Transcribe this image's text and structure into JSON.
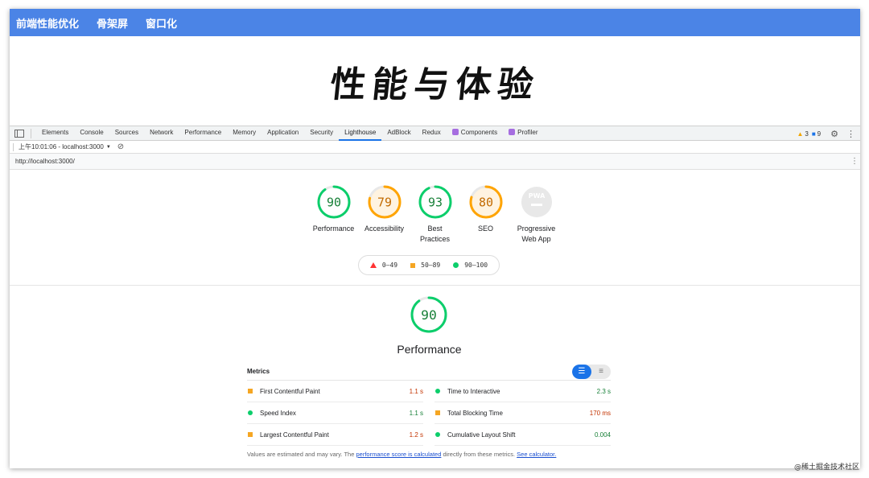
{
  "app_nav": [
    "前端性能优化",
    "骨架屏",
    "窗口化"
  ],
  "hero_title": "性能与体验",
  "devtools": {
    "tabs": [
      {
        "label": "Elements"
      },
      {
        "label": "Console"
      },
      {
        "label": "Sources"
      },
      {
        "label": "Network"
      },
      {
        "label": "Performance"
      },
      {
        "label": "Memory"
      },
      {
        "label": "Application"
      },
      {
        "label": "Security"
      },
      {
        "label": "Lighthouse",
        "active": true
      },
      {
        "label": "AdBlock"
      },
      {
        "label": "Redux"
      },
      {
        "label": "Components",
        "ext": true
      },
      {
        "label": "Profiler",
        "ext": true
      }
    ],
    "warnings_count": "3",
    "messages_count": "9",
    "report_selector": "上午10:01:06 - localhost:3000",
    "url": "http://localhost:3000/"
  },
  "scores": [
    {
      "label": "Performance",
      "value": 90,
      "color": "#0cce6b",
      "text_color": "#188038",
      "bg": "#ffffff"
    },
    {
      "label": "Accessibility",
      "value": 79,
      "color": "#ffa400",
      "text_color": "#c26a00",
      "bg": "#fff3e0"
    },
    {
      "label": "Best Practices",
      "value": 93,
      "color": "#0cce6b",
      "text_color": "#188038",
      "bg": "#ffffff"
    },
    {
      "label": "SEO",
      "value": 80,
      "color": "#ffa400",
      "text_color": "#c26a00",
      "bg": "#fff3e0"
    },
    {
      "label": "Progressive Web App",
      "value": null,
      "pwa_badge": "PWA",
      "color": "#cccccc",
      "bg": "#e8e8e8"
    }
  ],
  "legend": {
    "fail": "0–49",
    "average": "50–89",
    "pass": "90–100"
  },
  "performance": {
    "score": 90,
    "title": "Performance",
    "metrics_title": "Metrics",
    "metrics_left": [
      {
        "name": "First Contentful Paint",
        "value": "1.1 s",
        "status": "average"
      },
      {
        "name": "Speed Index",
        "value": "1.1 s",
        "status": "pass"
      },
      {
        "name": "Largest Contentful Paint",
        "value": "1.2 s",
        "status": "average"
      }
    ],
    "metrics_right": [
      {
        "name": "Time to Interactive",
        "value": "2.3 s",
        "status": "pass"
      },
      {
        "name": "Total Blocking Time",
        "value": "170 ms",
        "status": "average"
      },
      {
        "name": "Cumulative Layout Shift",
        "value": "0.004",
        "status": "pass"
      }
    ],
    "note_prefix": "Values are estimated and may vary. The ",
    "note_link1": "performance score is calculated",
    "note_middle": " directly from these metrics. ",
    "note_link2": "See calculator."
  },
  "watermark": "@稀土掘金技术社区"
}
